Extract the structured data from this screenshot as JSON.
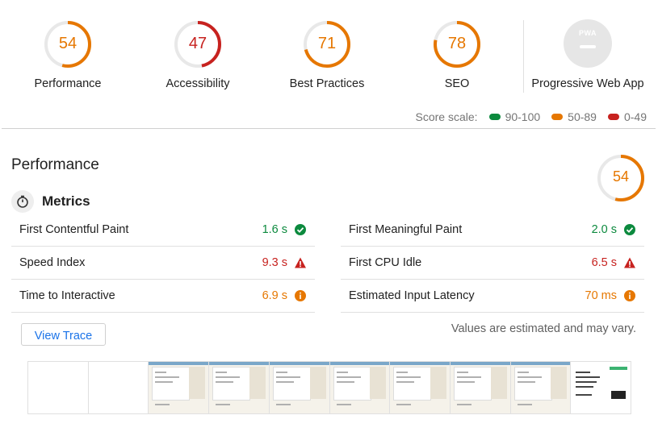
{
  "colors": {
    "pass": "#0c8a3e",
    "average": "#e67700",
    "fail": "#c7221f",
    "link": "#1a73e8"
  },
  "gauges": [
    {
      "label": "Performance",
      "score": "54",
      "value": 54,
      "status": "average"
    },
    {
      "label": "Accessibility",
      "score": "47",
      "value": 47,
      "status": "fail"
    },
    {
      "label": "Best Practices",
      "score": "71",
      "value": 71,
      "status": "average"
    },
    {
      "label": "SEO",
      "score": "78",
      "value": 78,
      "status": "average"
    }
  ],
  "pwa": {
    "label": "Progressive Web App",
    "badge_text": "PWA"
  },
  "score_scale": {
    "label": "Score scale:",
    "ranges": [
      {
        "text": "90-100",
        "status": "pass"
      },
      {
        "text": "50-89",
        "status": "average"
      },
      {
        "text": "0-49",
        "status": "fail"
      }
    ]
  },
  "category": {
    "title": "Performance",
    "score": "54",
    "value": 54
  },
  "metrics": {
    "heading": "Metrics",
    "items": [
      {
        "name": "First Contentful Paint",
        "value": "1.6 s",
        "status": "pass"
      },
      {
        "name": "First Meaningful Paint",
        "value": "2.0 s",
        "status": "pass"
      },
      {
        "name": "Speed Index",
        "value": "9.3 s",
        "status": "fail"
      },
      {
        "name": "First CPU Idle",
        "value": "6.5 s",
        "status": "fail"
      },
      {
        "name": "Time to Interactive",
        "value": "6.9 s",
        "status": "average"
      },
      {
        "name": "Estimated Input Latency",
        "value": "70 ms",
        "status": "average"
      }
    ]
  },
  "view_trace_label": "View Trace",
  "estimate_note": "Values are estimated and may vary.",
  "filmstrip": {
    "frames": [
      "blank",
      "blank",
      "loaded",
      "loaded",
      "loaded",
      "loaded",
      "loaded",
      "loaded",
      "loaded",
      "final"
    ]
  }
}
